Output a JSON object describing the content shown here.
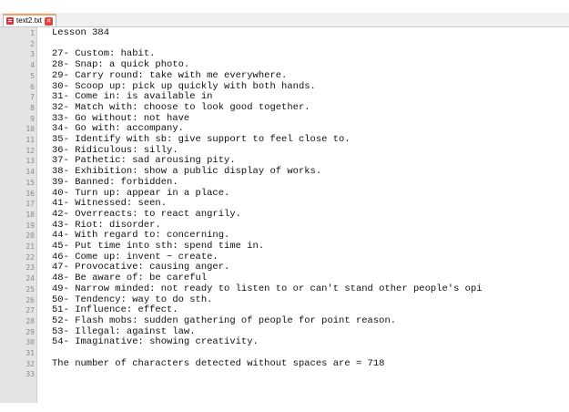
{
  "tab": {
    "filename": "text2.txt",
    "close_glyph": "✕"
  },
  "editor": {
    "lines": [
      "Lesson 384",
      "",
      "27- Custom: habit.",
      "28- Snap: a quick photo.",
      "29- Carry round: take with me everywhere.",
      "30- Scoop up: pick up quickly with both hands.",
      "31- Come in: is available in",
      "32- Match with: choose to look good together.",
      "33- Go without: not have",
      "34- Go with: accompany.",
      "35- Identify with sb: give support to feel close to.",
      "36- Ridiculous: silly.",
      "37- Pathetic: sad arousing pity.",
      "38- Exhibition: show a public display of works.",
      "39- Banned: forbidden.",
      "40- Turn up: appear in a place.",
      "41- Witnessed: seen.",
      "42- Overreacts: to react angrily.",
      "43- Riot: disorder.",
      "44- With regard to: concerning.",
      "45- Put time into sth: spend time in.",
      "46- Come up: invent ~ create.",
      "47- Provocative: causing anger.",
      "48- Be aware of: be careful",
      "49- Narrow minded: not ready to listen to or can't stand other people's opi",
      "50- Tendency: way to do sth.",
      "51- Influence: effect.",
      "52- Flash mobs: sudden gathering of people for point reason.",
      "53- Illegal: against law.",
      "54- Imaginative: showing creativity.",
      "",
      "The number of characters detected without spaces are = 718",
      ""
    ]
  }
}
